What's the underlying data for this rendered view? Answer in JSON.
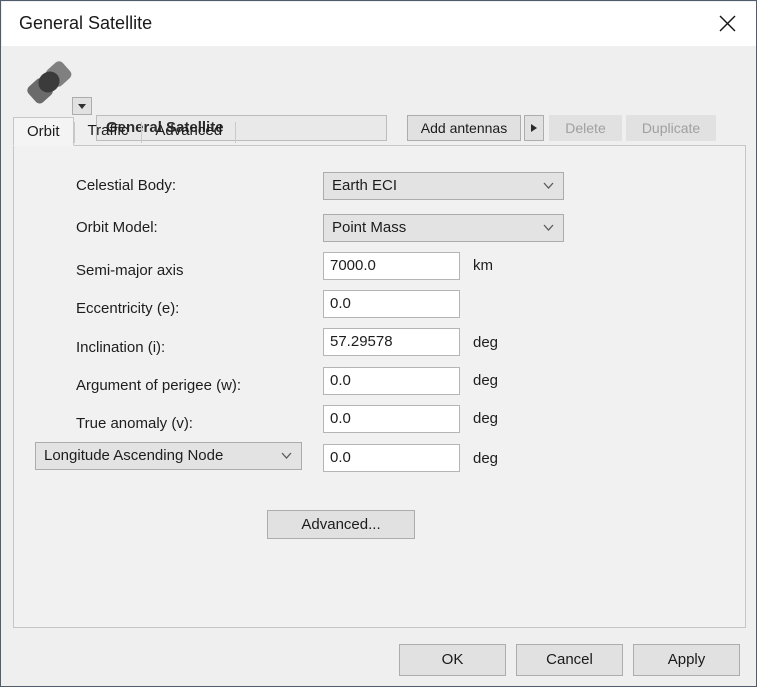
{
  "window": {
    "title": "General Satellite",
    "close_icon": "close-icon"
  },
  "header": {
    "satellite_icon": "satellite-icon",
    "icon_dropdown_icon": "chevron-down-icon",
    "name_value": "General Satellite",
    "add_antennas_label": "Add antennas",
    "add_antennas_arrow_icon": "triangle-right-icon",
    "delete_label": "Delete",
    "duplicate_label": "Duplicate"
  },
  "tabs": [
    {
      "label": "Orbit",
      "active": true
    },
    {
      "label": "Traffic",
      "active": false
    },
    {
      "label": "Advanced",
      "active": false
    }
  ],
  "form": {
    "celestial_body": {
      "label": "Celestial Body:",
      "value": "Earth ECI",
      "chevron_icon": "chevron-down-icon"
    },
    "orbit_model": {
      "label": "Orbit Model:",
      "value": "Point Mass",
      "chevron_icon": "chevron-down-icon"
    },
    "semi_major_axis": {
      "label": "Semi-major axis",
      "value": "7000.0",
      "unit": "km"
    },
    "eccentricity": {
      "label": "Eccentricity (e):",
      "value": "0.0",
      "unit": ""
    },
    "inclination": {
      "label": "Inclination (i):",
      "value": "57.29578",
      "unit": "deg"
    },
    "argument_of_perigee": {
      "label": "Argument of perigee (w):",
      "value": "0.0",
      "unit": "deg"
    },
    "true_anomaly": {
      "label": "True anomaly (v):",
      "value": "0.0",
      "unit": "deg"
    },
    "node_selector": {
      "value": "Longitude Ascending Node",
      "chevron_icon": "chevron-down-icon",
      "field_value": "0.0",
      "unit": "deg"
    },
    "advanced_button_label": "Advanced..."
  },
  "footer": {
    "ok_label": "OK",
    "cancel_label": "Cancel",
    "apply_label": "Apply"
  },
  "colors": {
    "dialog_bg": "#efefef",
    "panel_bg": "#f1f1f1",
    "button_bg": "#e1e1e1",
    "select_bg": "#e3e3e3",
    "input_bg": "#ffffff",
    "border": "#acacac",
    "text": "#1d1d1d",
    "disabled_text": "#a0a0a0",
    "icon_panel": "#6e6e6e",
    "icon_body": "#3f3f3f"
  }
}
